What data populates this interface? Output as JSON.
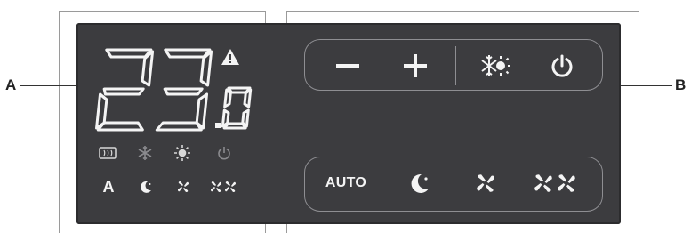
{
  "callouts": {
    "left": "A",
    "right": "B"
  },
  "display": {
    "temperature_integer": "23",
    "temperature_decimal": "0",
    "alarm_icon": "warning-triangle-icon"
  },
  "status_icons": {
    "row1": [
      "heater-icon",
      "snowflake-icon",
      "sun-icon",
      "power-icon"
    ],
    "row2": [
      "A",
      "moon-icon",
      "fan-low-icon",
      "fan-high-icon"
    ]
  },
  "controls": {
    "minus_label": "−",
    "plus_label": "+",
    "mode_icon": "snow-sun-icon",
    "power_icon": "power-icon"
  },
  "fan_controls": {
    "auto_label": "AUTO",
    "night_icon": "moon-icon",
    "speed1_icon": "fan-icon",
    "speed2_icon": "double-fan-icon"
  },
  "colors": {
    "panel": "#3c3c3f",
    "text": "#f4f4f4",
    "border": "#8e8e92",
    "dim_icon": "#8a8a8e"
  }
}
